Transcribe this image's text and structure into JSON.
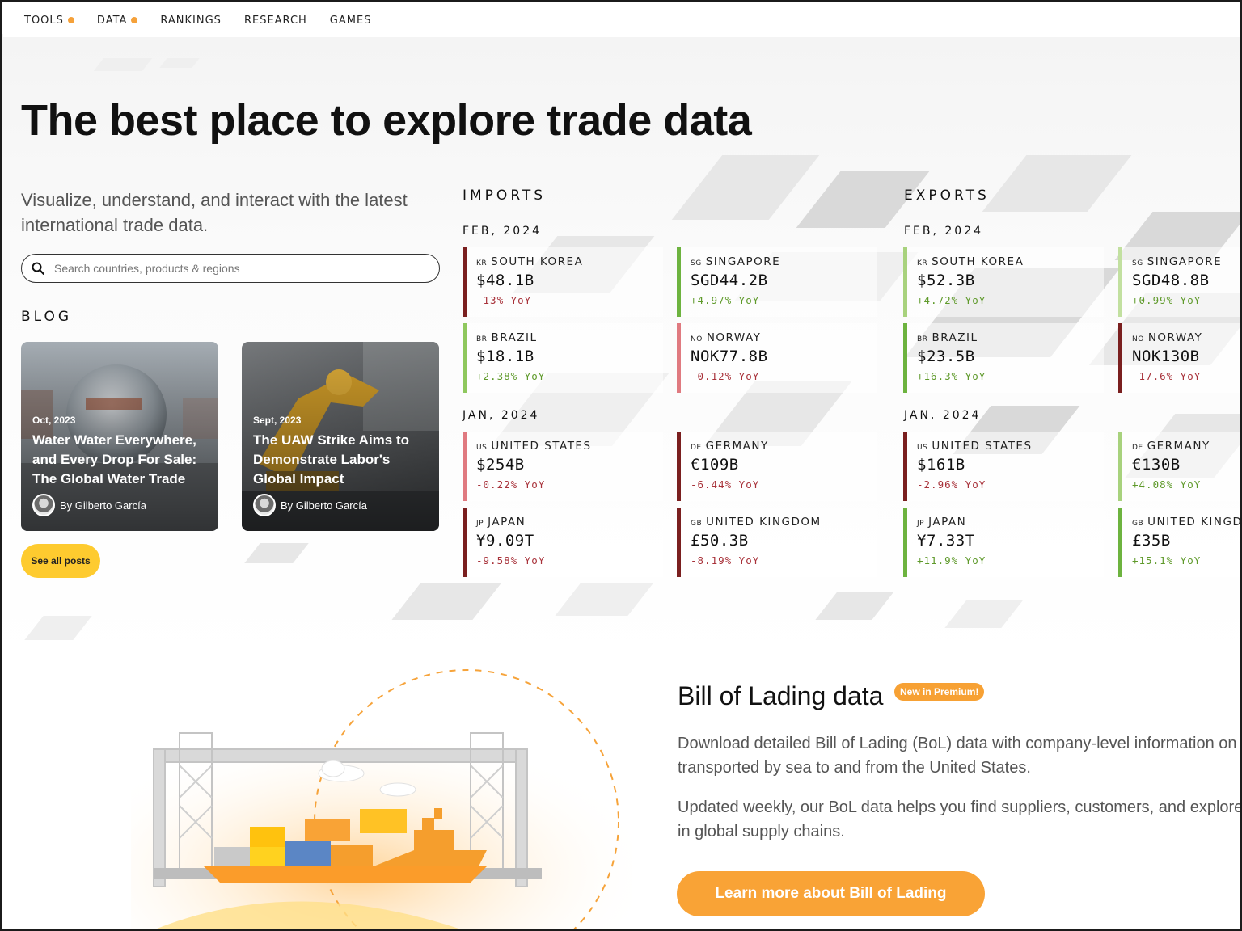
{
  "nav": {
    "items": [
      {
        "label": "TOOLS",
        "dot": true
      },
      {
        "label": "DATA",
        "dot": true
      },
      {
        "label": "RANKINGS",
        "dot": false
      },
      {
        "label": "RESEARCH",
        "dot": false
      },
      {
        "label": "GAMES",
        "dot": false
      }
    ]
  },
  "hero": {
    "title": "The best place to explore trade data",
    "subtitle": "Visualize, understand, and interact with the latest international trade data.",
    "search_placeholder": "Search countries, products & regions"
  },
  "blog": {
    "heading": "BLOG",
    "posts": [
      {
        "date": "Oct, 2023",
        "title": "Water Water Everywhere, and Every Drop For Sale: The Global Water Trade",
        "author": "By Gilberto García"
      },
      {
        "date": "Sept, 2023",
        "title": "The UAW Strike Aims to Demonstrate Labor's Global Impact",
        "author": "By Gilberto García"
      }
    ],
    "see_all": "See all posts"
  },
  "imports": {
    "heading": "IMPORTS",
    "periods": [
      {
        "label": "FEB, 2024",
        "rows": [
          {
            "code": "KR",
            "country": "SOUTH KOREA",
            "value": "$48.1B",
            "change": "-13% YoY",
            "dir": "down",
            "bar": "#7a1f1f"
          },
          {
            "code": "SG",
            "country": "SINGAPORE",
            "value": "SGD44.2B",
            "change": "+4.97% YoY",
            "dir": "up",
            "bar": "#6db33f"
          },
          {
            "code": "BR",
            "country": "BRAZIL",
            "value": "$18.1B",
            "change": "+2.38% YoY",
            "dir": "up",
            "bar": "#8fc85e"
          },
          {
            "code": "NO",
            "country": "NORWAY",
            "value": "NOK77.8B",
            "change": "-0.12% YoY",
            "dir": "down",
            "bar": "#e07a80"
          }
        ]
      },
      {
        "label": "JAN, 2024",
        "rows": [
          {
            "code": "US",
            "country": "UNITED STATES",
            "value": "$254B",
            "change": "-0.22% YoY",
            "dir": "down",
            "bar": "#e07a80"
          },
          {
            "code": "DE",
            "country": "GERMANY",
            "value": "€109B",
            "change": "-6.44% YoY",
            "dir": "down",
            "bar": "#7a1f1f"
          },
          {
            "code": "JP",
            "country": "JAPAN",
            "value": "¥9.09T",
            "change": "-9.58% YoY",
            "dir": "down",
            "bar": "#7a1f1f"
          },
          {
            "code": "GB",
            "country": "UNITED KINGDOM",
            "value": "£50.3B",
            "change": "-8.19% YoY",
            "dir": "down",
            "bar": "#7a1f1f"
          }
        ]
      }
    ]
  },
  "exports": {
    "heading": "EXPORTS",
    "periods": [
      {
        "label": "FEB, 2024",
        "rows": [
          {
            "code": "KR",
            "country": "SOUTH KOREA",
            "value": "$52.3B",
            "change": "+4.72% YoY",
            "dir": "up",
            "bar": "#a8d27d"
          },
          {
            "code": "SG",
            "country": "SINGAPORE",
            "value": "SGD48.8B",
            "change": "+0.99% YoY",
            "dir": "up",
            "bar": "#c2e0a0"
          },
          {
            "code": "BR",
            "country": "BRAZIL",
            "value": "$23.5B",
            "change": "+16.3% YoY",
            "dir": "up",
            "bar": "#6db33f"
          },
          {
            "code": "NO",
            "country": "NORWAY",
            "value": "NOK130B",
            "change": "-17.6% YoY",
            "dir": "down",
            "bar": "#7a1f1f"
          }
        ]
      },
      {
        "label": "JAN, 2024",
        "rows": [
          {
            "code": "US",
            "country": "UNITED STATES",
            "value": "$161B",
            "change": "-2.96% YoY",
            "dir": "down",
            "bar": "#7a1f1f"
          },
          {
            "code": "DE",
            "country": "GERMANY",
            "value": "€130B",
            "change": "+4.08% YoY",
            "dir": "up",
            "bar": "#a8d27d"
          },
          {
            "code": "JP",
            "country": "JAPAN",
            "value": "¥7.33T",
            "change": "+11.9% YoY",
            "dir": "up",
            "bar": "#6db33f"
          },
          {
            "code": "GB",
            "country": "UNITED KINGDOM",
            "value": "£35B",
            "change": "+15.1% YoY",
            "dir": "up",
            "bar": "#6db33f"
          }
        ]
      }
    ]
  },
  "bol": {
    "title": "Bill of Lading data",
    "badge": "New in Premium!",
    "p1_line1": "Download detailed Bill of Lading (BoL) data with company-level information on goods",
    "p1_line2": "transported by sea to and from the United States.",
    "p2_line1": "Updated weekly, our BoL data helps you find suppliers, customers, and explore trends",
    "p2_line2": "in global supply chains.",
    "button": "Learn more about Bill of Lading"
  },
  "colors": {
    "accent_yellow": "#fecb2f",
    "accent_orange": "#f9a336",
    "up_text": "#5f9a2b",
    "down_text": "#a8323a"
  }
}
